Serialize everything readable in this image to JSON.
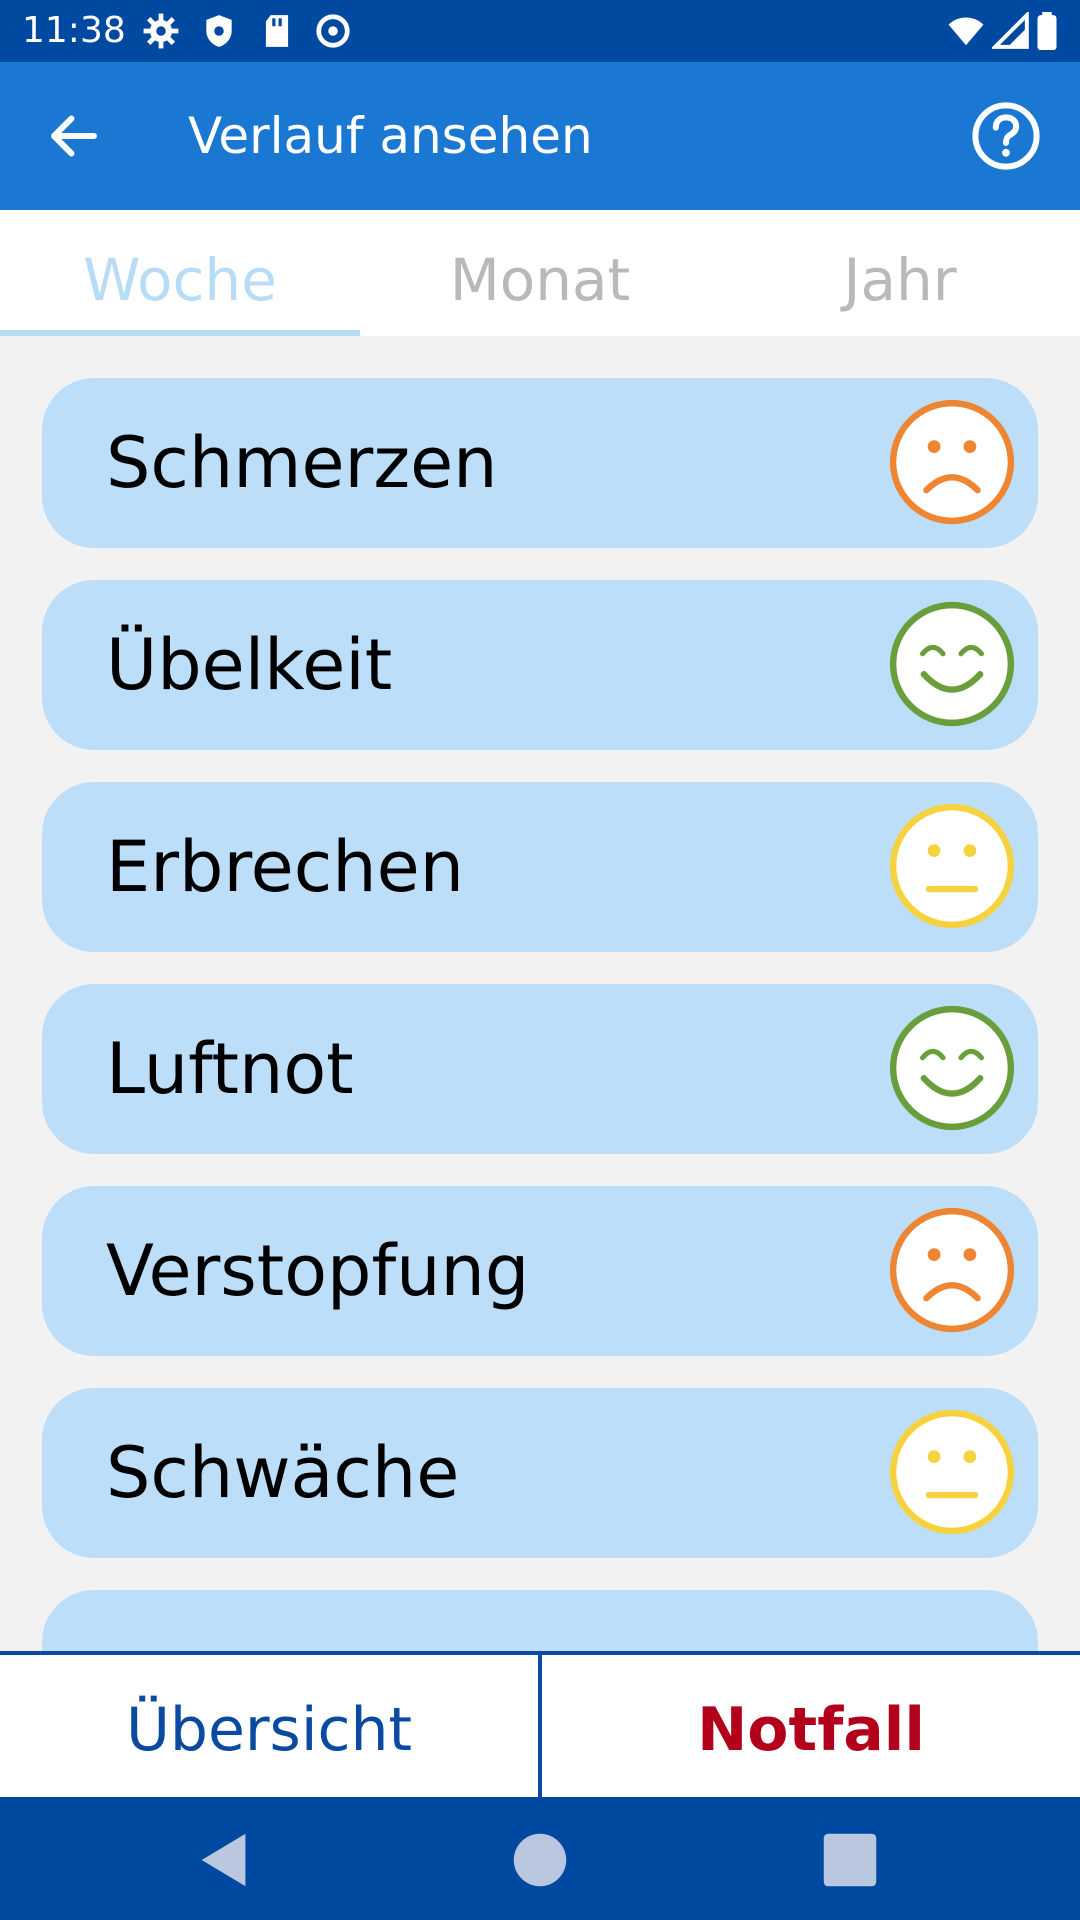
{
  "status_bar": {
    "time": "11:38",
    "icons": [
      "settings-icon",
      "shield-icon",
      "sd-card-icon",
      "at-icon",
      "wifi-icon",
      "signal-icon",
      "battery-icon"
    ]
  },
  "app_bar": {
    "title": "Verlauf ansehen",
    "back_icon": "arrow-left-icon",
    "help_icon": "help-circle-icon"
  },
  "tabs": [
    {
      "label": "Woche",
      "active": true
    },
    {
      "label": "Monat",
      "active": false
    },
    {
      "label": "Jahr",
      "active": false
    }
  ],
  "symptoms": [
    {
      "label": "Schmerzen",
      "mood": "sad",
      "color": "#ee8533"
    },
    {
      "label": "Übelkeit",
      "mood": "happy",
      "color": "#6a9e3c"
    },
    {
      "label": "Erbrechen",
      "mood": "neutral",
      "color": "#f6d23e"
    },
    {
      "label": "Luftnot",
      "mood": "happy",
      "color": "#6a9e3c"
    },
    {
      "label": "Verstopfung",
      "mood": "sad",
      "color": "#ee8533"
    },
    {
      "label": "Schwäche",
      "mood": "neutral",
      "color": "#f6d23e"
    }
  ],
  "bottom_bar": {
    "overview_label": "Übersicht",
    "emergency_label": "Notfall"
  },
  "colors": {
    "status_bar": "#0049a0",
    "app_bar": "#1a78d3",
    "card": "#bcdef8",
    "emergency": "#b3001b",
    "overview": "#0a4aa0"
  }
}
